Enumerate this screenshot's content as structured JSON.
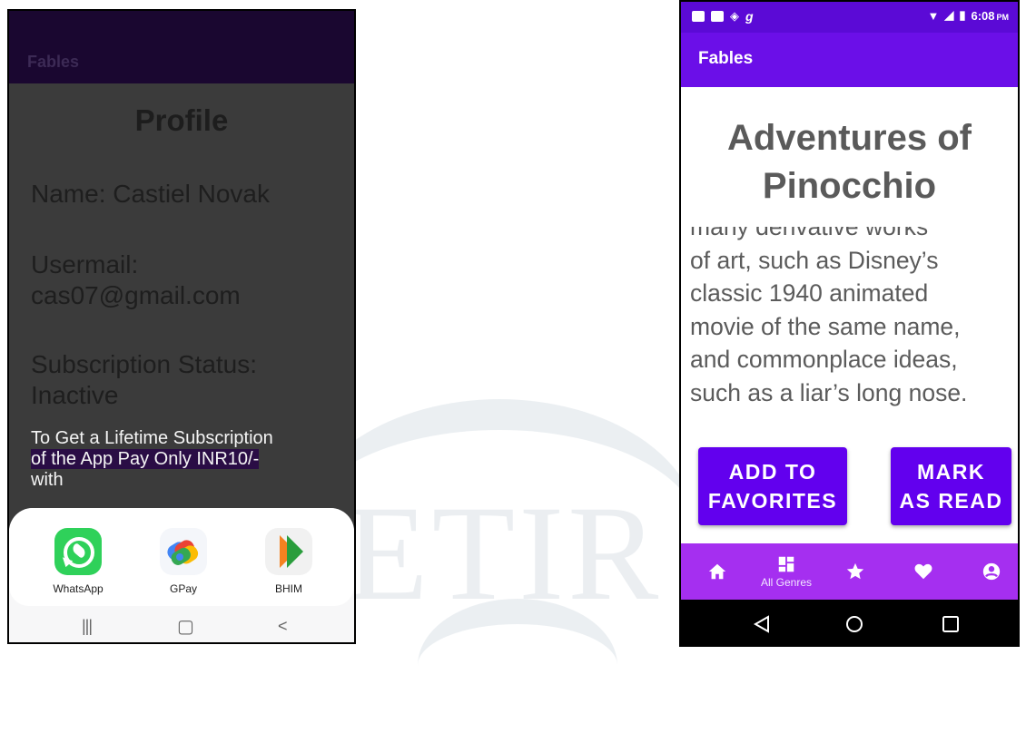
{
  "left_screen": {
    "app_title": "Fables",
    "heading": "Profile",
    "name_line": "Name: Castiel Novak",
    "email_label": "Usermail:",
    "email_value": "cas07@gmail.com",
    "subscription_label": "Subscription Status:",
    "subscription_value": "Inactive",
    "prompt_line1": "To Get a Lifetime Subscription",
    "prompt_line2": "of the App Pay Only INR10/-",
    "prompt_line3": "with",
    "share_apps": [
      {
        "label": "WhatsApp",
        "icon": "whatsapp-icon"
      },
      {
        "label": "GPay",
        "icon": "gpay-icon"
      },
      {
        "label": "BHIM",
        "icon": "bhim-icon"
      }
    ],
    "nav_buttons": [
      {
        "icon": "recents-icon",
        "glyph": "|||"
      },
      {
        "icon": "home-icon",
        "glyph": "▢"
      },
      {
        "icon": "back-icon",
        "glyph": "<"
      }
    ]
  },
  "right_screen": {
    "status_bar": {
      "left_glyph": "g",
      "time": "6:08",
      "ampm": "PM"
    },
    "app_title": "Fables",
    "story_title_line1": "Adventures of",
    "story_title_line2": "Pinocchio",
    "story_lines": [
      "many derivative works",
      "of art, such as Disney’s",
      "classic 1940 animated",
      "movie of the same name,",
      "and commonplace ideas,",
      "such as a liar’s long nose."
    ],
    "favorites_button_line1": "ADD TO",
    "favorites_button_line2": "FAVORITES",
    "read_button_line1": "MARK",
    "read_button_line2": "AS READ",
    "bottom_nav": [
      {
        "icon": "home-icon",
        "label": ""
      },
      {
        "icon": "grid-icon",
        "label": "All Genres"
      },
      {
        "icon": "star-icon",
        "label": ""
      },
      {
        "icon": "heart-icon",
        "label": ""
      },
      {
        "icon": "account-icon",
        "label": ""
      }
    ],
    "system_nav": [
      "back-triangle-icon",
      "home-circle-icon",
      "recents-square-icon"
    ]
  },
  "colors": {
    "left_appbar": "#1a0730",
    "left_background": "#3b3b3b",
    "right_statusbar": "#5b0ad6",
    "right_appbar": "#6b0fe8",
    "button": "#6200ee",
    "bottom_nav": "#a52ff0"
  }
}
